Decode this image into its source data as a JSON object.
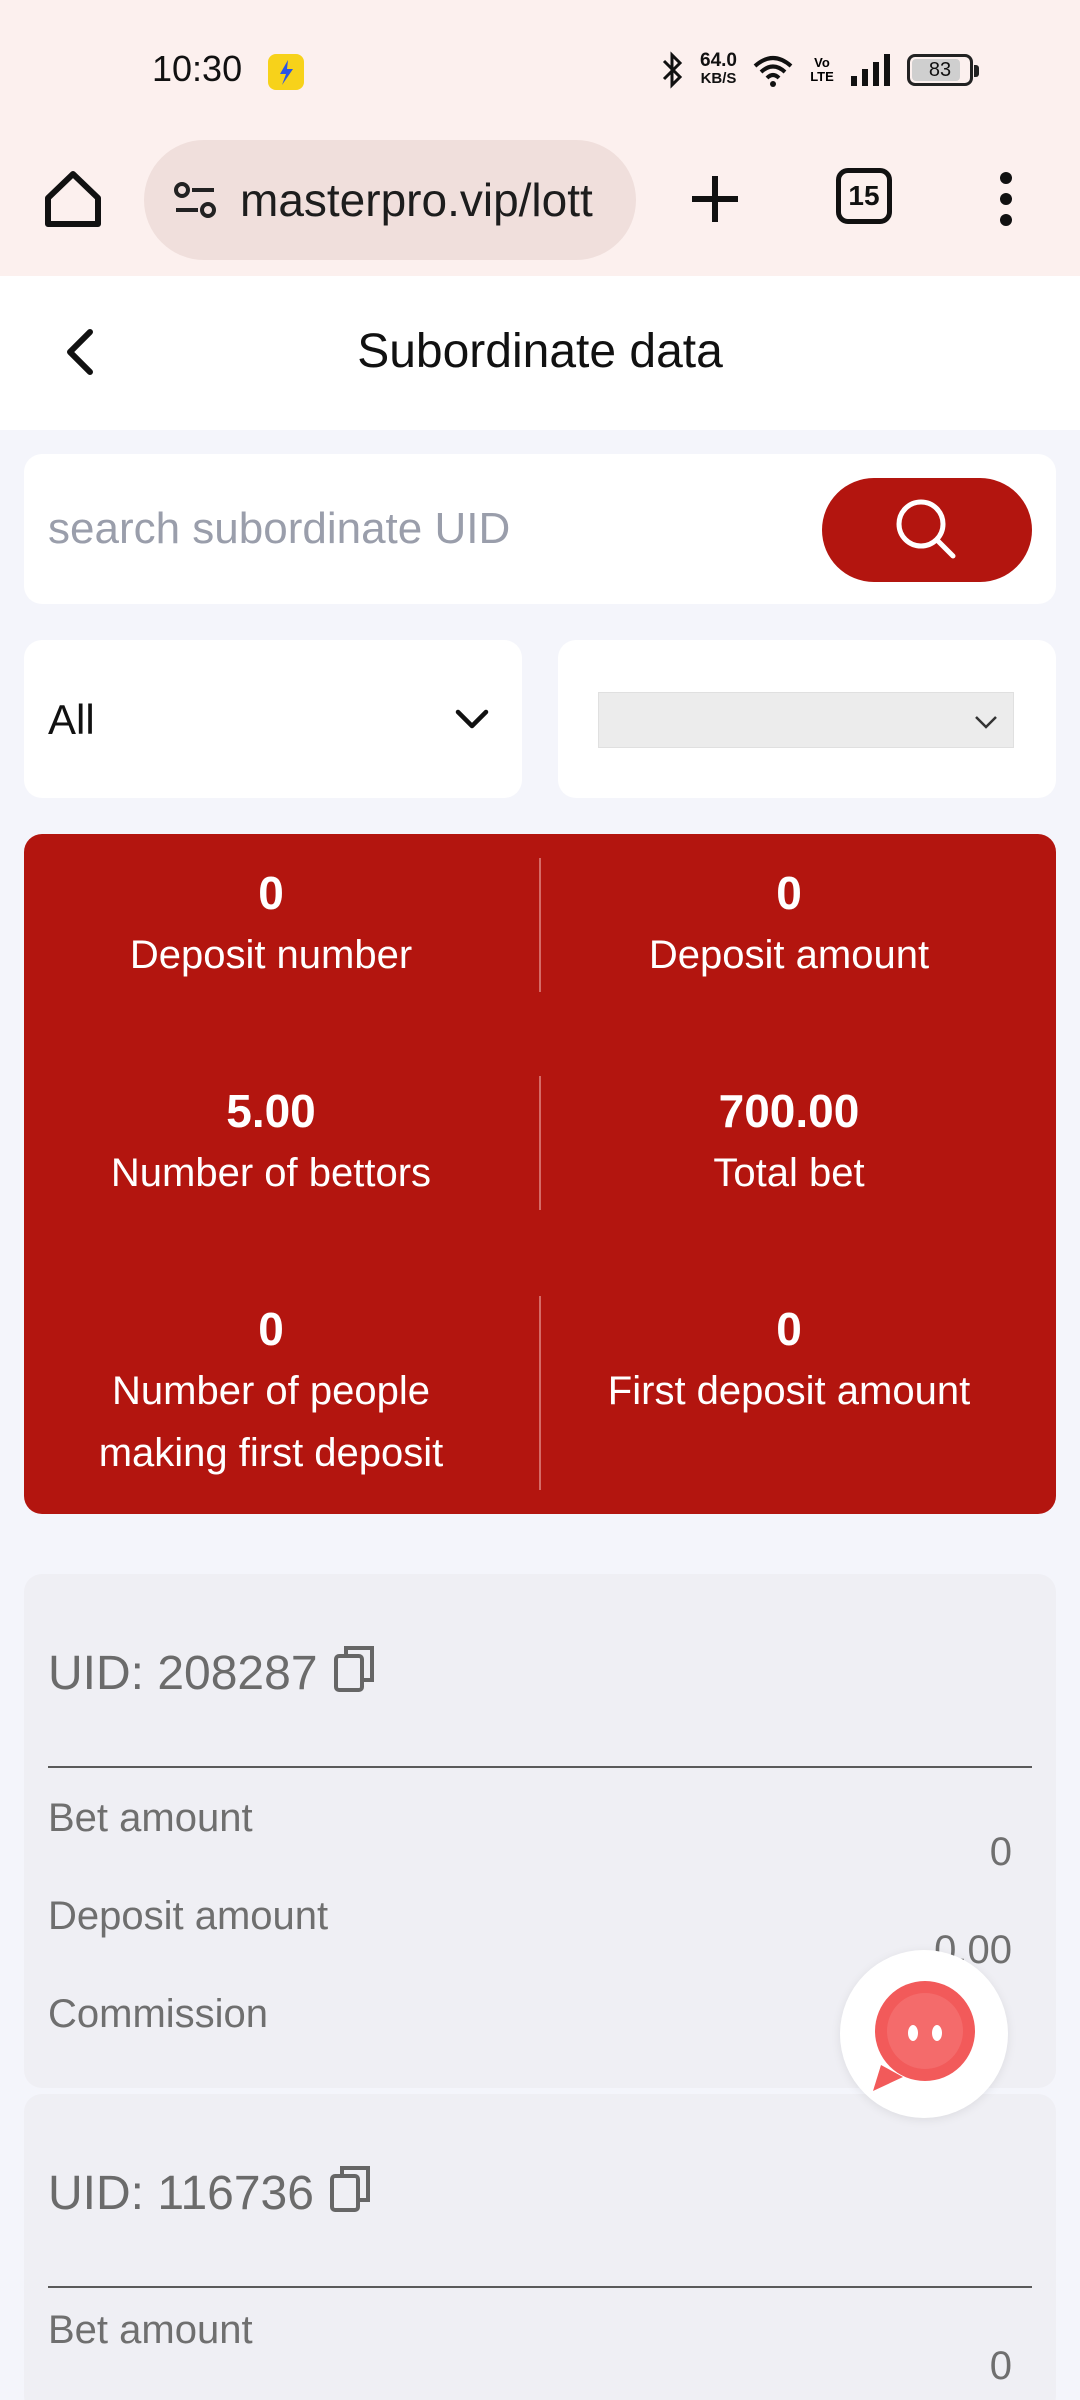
{
  "status_bar": {
    "time": "10:30",
    "speed_value": "64.0",
    "speed_unit": "KB/S",
    "network_label": "Vo LTE",
    "battery": "83"
  },
  "browser": {
    "url": "masterpro.vip/lott",
    "tab_count": "15"
  },
  "header": {
    "title": "Subordinate data"
  },
  "search": {
    "placeholder": "search subordinate UID",
    "value": ""
  },
  "filters": {
    "type_value": "All",
    "date_value": ""
  },
  "stats": [
    {
      "value": "0",
      "label": "Deposit number"
    },
    {
      "value": "0",
      "label": "Deposit amount"
    },
    {
      "value": "5.00",
      "label": "Number of bettors"
    },
    {
      "value": "700.00",
      "label": "Total bet"
    },
    {
      "value": "0",
      "label_line1": "Number of people",
      "label_line2": "making first deposit"
    },
    {
      "value": "0",
      "label": "First deposit amount"
    }
  ],
  "records": [
    {
      "uid": "UID: 208287",
      "bet_label": "Bet amount",
      "bet_value": "0",
      "deposit_label": "Deposit amount",
      "deposit_value": "0.00",
      "commission_label": "Commission"
    },
    {
      "uid": "UID: 116736",
      "bet_label": "Bet amount",
      "bet_value": "0"
    }
  ],
  "colors": {
    "brand_red": "#b3150f",
    "page_bg": "#f4f5fb",
    "browser_bg": "#fcf0ee"
  }
}
